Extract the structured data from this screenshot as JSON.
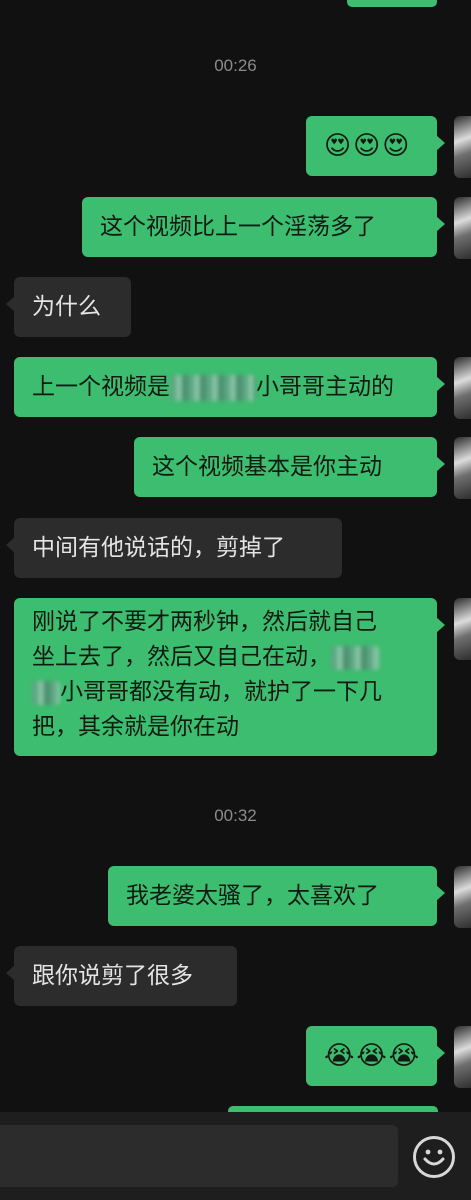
{
  "conversation": {
    "timestamps": [
      "00:26",
      "00:32"
    ],
    "messages": [
      {
        "side": "sent",
        "text": "😍😍😍"
      },
      {
        "side": "sent",
        "text": "这个视频比上一个淫荡多了"
      },
      {
        "side": "recv",
        "text": "为什么"
      },
      {
        "side": "sent",
        "text_before": "上一个视频是",
        "text_after": "小哥哥主动的"
      },
      {
        "side": "sent",
        "text": "这个视频基本是你主动"
      },
      {
        "side": "recv",
        "text": "中间有他说话的，剪掉了"
      },
      {
        "side": "sent",
        "line1": "刚说了不要才两秒钟，然后就自己",
        "line2": "坐上去了，然后又自己在动，",
        "line3": "小哥哥都没有动，就护了一下几",
        "line4": "把，其余就是你在动"
      },
      {
        "side": "sent",
        "text": "我老婆太骚了，太喜欢了"
      },
      {
        "side": "recv",
        "text": "跟你说剪了很多"
      },
      {
        "side": "sent",
        "text": "😭😭😭"
      }
    ]
  },
  "input_bar": {
    "emoji_icon": "smiley-face-icon"
  },
  "colors": {
    "background": "#111111",
    "sent_bubble": "#3dbd6f",
    "received_bubble": "#2c2c2c",
    "timestamp": "#8c8c8c"
  }
}
